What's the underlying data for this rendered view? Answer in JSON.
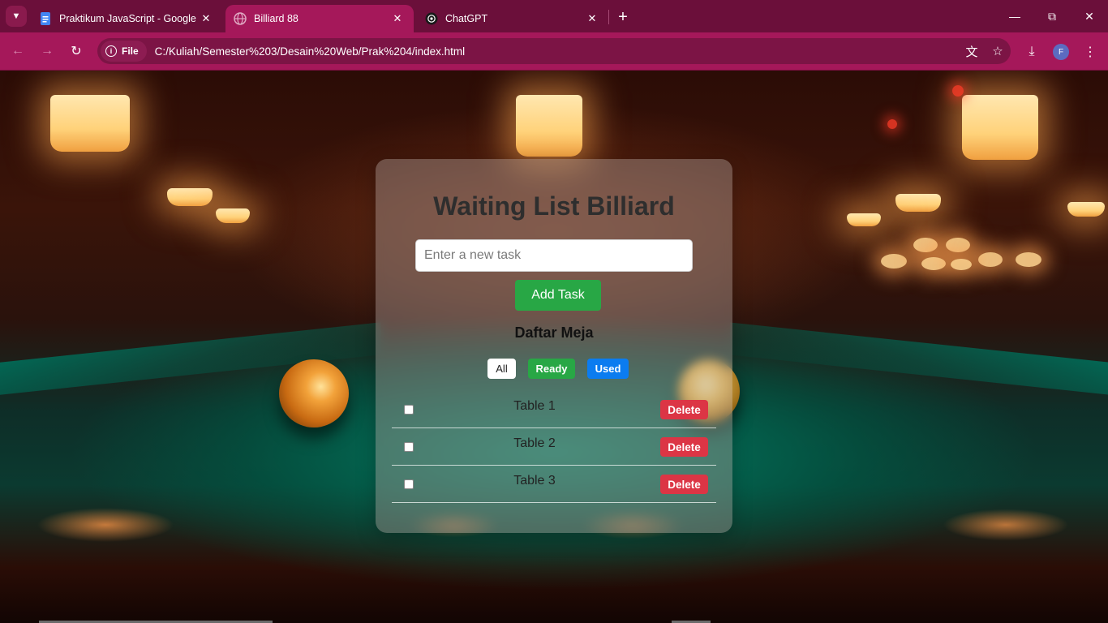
{
  "browser": {
    "tabs": [
      {
        "title": "Praktikum JavaScript - Google D",
        "icon": "google-docs-icon",
        "active": false
      },
      {
        "title": "Billiard 88",
        "icon": "globe-icon",
        "active": true
      },
      {
        "title": "ChatGPT",
        "icon": "chatgpt-icon",
        "active": false
      }
    ],
    "address": {
      "chip_label": "File",
      "url": "C:/Kuliah/Semester%203/Desain%20Web/Prak%204/index.html"
    },
    "profile_initial": "F",
    "theme": {
      "tabbar": "#6b0f3a",
      "toolbar": "#a5185a"
    }
  },
  "app": {
    "title": "Waiting List Billiard",
    "input_placeholder": "Enter a new task",
    "input_value": "",
    "add_button": "Add Task",
    "list_title": "Daftar Meja",
    "filters": {
      "all": "All",
      "ready": "Ready",
      "used": "Used"
    },
    "tables": [
      {
        "name": "Table 1",
        "checked": false,
        "delete_label": "Delete"
      },
      {
        "name": "Table 2",
        "checked": false,
        "delete_label": "Delete"
      },
      {
        "name": "Table 3",
        "checked": false,
        "delete_label": "Delete"
      }
    ],
    "colors": {
      "add": "#28a745",
      "ready": "#28a745",
      "used": "#0b7cf0",
      "delete": "#dc3545"
    }
  }
}
